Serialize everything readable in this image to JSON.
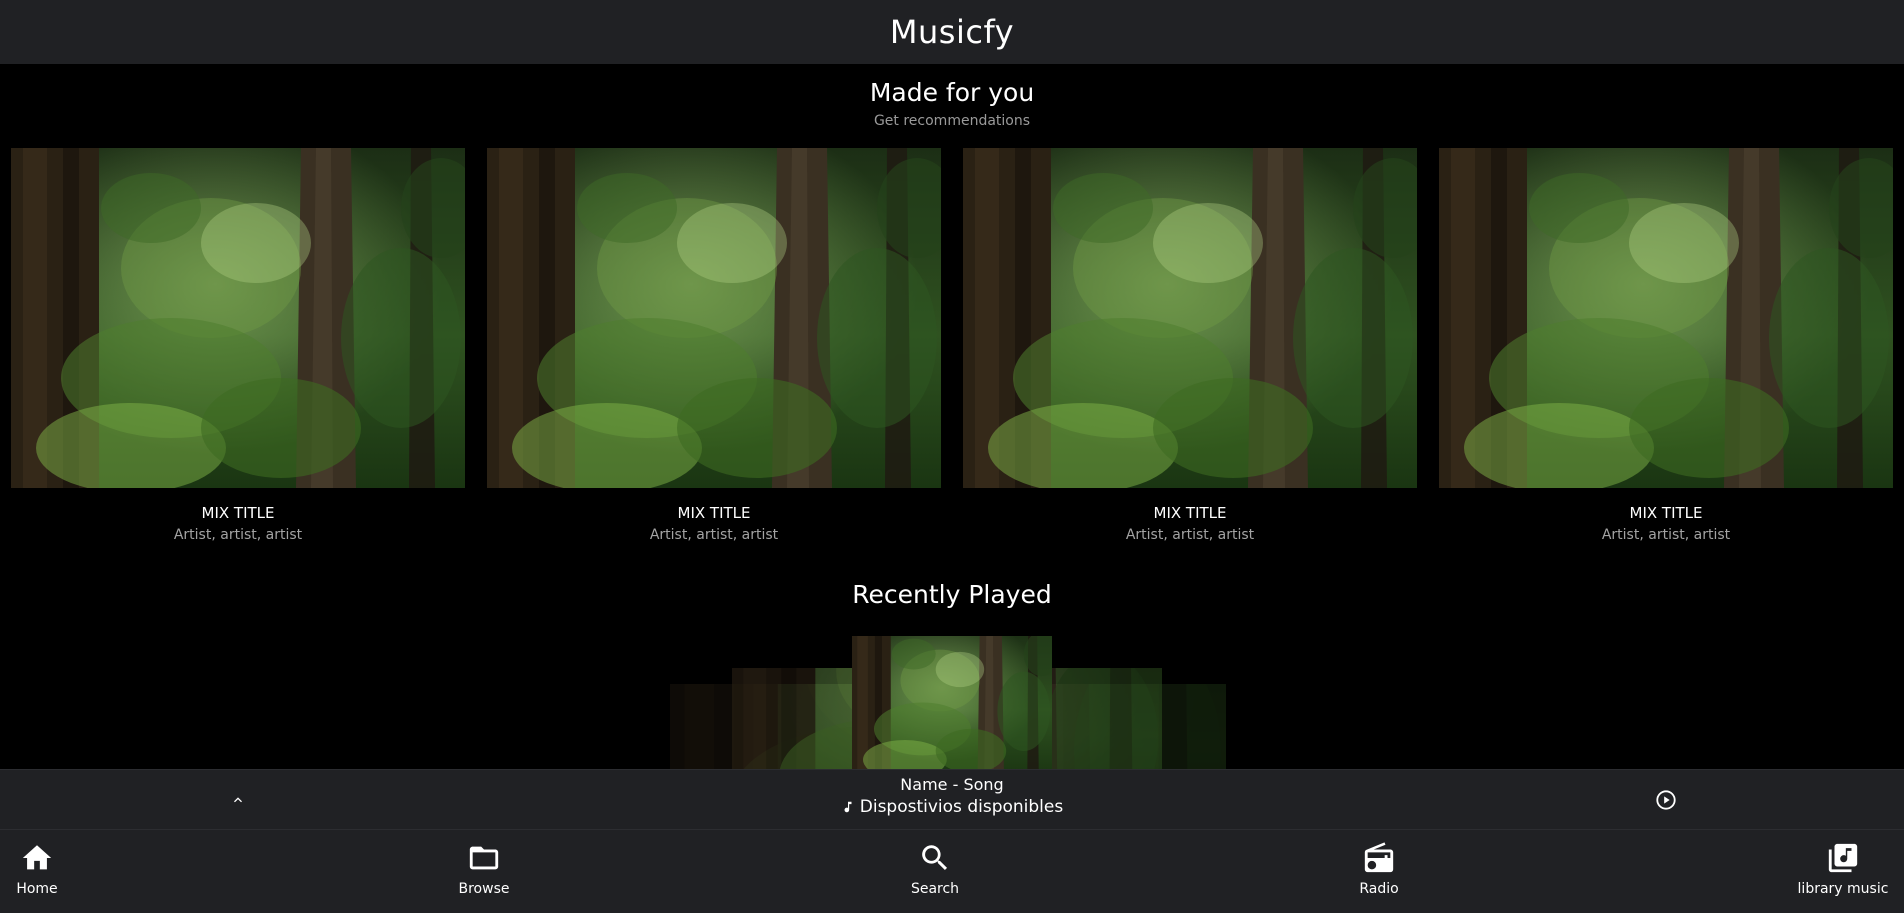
{
  "header": {
    "title": "Musicfy"
  },
  "made_for_you": {
    "title": "Made for you",
    "subtitle": "Get recommendations",
    "mixes": [
      {
        "title": "MIX TITLE",
        "artists": "Artist, artist, artist"
      },
      {
        "title": "MIX TITLE",
        "artists": "Artist, artist, artist"
      },
      {
        "title": "MIX TITLE",
        "artists": "Artist, artist, artist"
      },
      {
        "title": "MIX TITLE",
        "artists": "Artist, artist, artist"
      }
    ]
  },
  "recently_played": {
    "title": "Recently Played"
  },
  "now_playing": {
    "song": "Name - Song",
    "devices_label": "Dispostivios disponibles",
    "icons": {
      "expand": "chevron-up-icon",
      "device": "music-note-icon",
      "play": "play-circle-icon"
    }
  },
  "bottom_nav": {
    "items": [
      {
        "label": "Home",
        "icon": "home-icon"
      },
      {
        "label": "Browse",
        "icon": "folder-icon"
      },
      {
        "label": "Search",
        "icon": "search-icon"
      },
      {
        "label": "Radio",
        "icon": "radio-icon"
      },
      {
        "label": "library music",
        "icon": "library-music-icon"
      }
    ]
  },
  "colors": {
    "bar_background": "#202124",
    "content_background": "#000000",
    "secondary_text": "#9a9a9a"
  }
}
